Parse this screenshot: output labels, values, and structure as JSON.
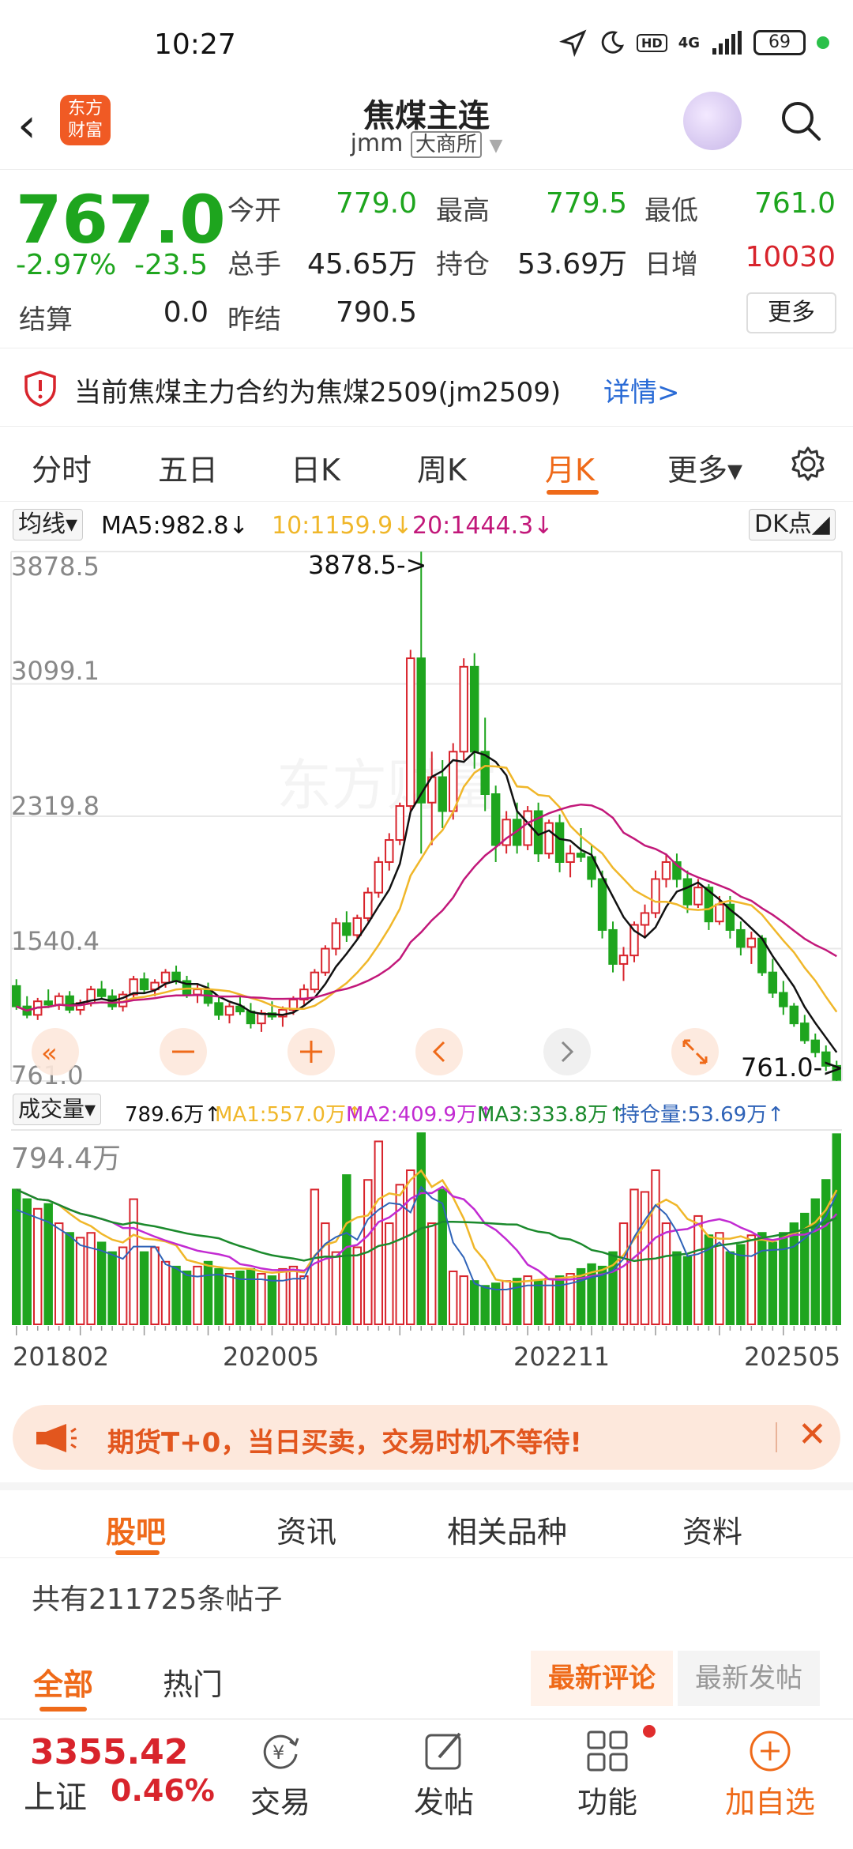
{
  "status": {
    "time": "10:27",
    "network": "4G",
    "hd": "HD",
    "battery": "69"
  },
  "header": {
    "title": "焦煤主连",
    "code": "jmm",
    "exchange": "大商所",
    "logo_line1": "东方",
    "logo_line2": "财富"
  },
  "quote": {
    "price": "767.0",
    "change_pct": "-2.97%",
    "change": "-23.5",
    "open_label": "今开",
    "open": "779.0",
    "high_label": "最高",
    "high": "779.5",
    "low_label": "最低",
    "low": "761.0",
    "volume_label": "总手",
    "volume": "45.65万",
    "oi_label": "持仓",
    "oi": "53.69万",
    "oi_inc_label": "日增",
    "oi_inc": "10030",
    "settle_label": "结算",
    "settle": "0.0",
    "prev_settle_label": "昨结",
    "prev_settle": "790.5",
    "more_label": "更多"
  },
  "notice": {
    "text": "当前焦煤主力合约为焦煤2509(jm2509)",
    "link": "详情>"
  },
  "tabs": [
    "分时",
    "五日",
    "日K",
    "周K",
    "月K",
    "更多▾"
  ],
  "ma_legend": {
    "select": "均线▾",
    "ma5": "MA5:982.8↓",
    "ma10": "10:1159.9↓",
    "ma20": "20:1444.3↓",
    "dk": "DK点◢"
  },
  "colors": {
    "accent": "#ef6a19",
    "up": "#d8242c",
    "down": "#1ea51e",
    "ma5": "#111111",
    "ma10": "#f0b72a",
    "ma20": "#c2187a",
    "ma3": "#1b8a2c",
    "oi_line": "#2f63b8"
  },
  "kchart": {
    "y_labels": [
      "3878.5",
      "3099.1",
      "2319.8",
      "1540.4",
      "761.0"
    ],
    "max_callout": "3878.5->",
    "min_callout": "761.0->",
    "watermark": "东方财富"
  },
  "vol_legend": {
    "select": "成交量▾",
    "vol": "789.6万↑",
    "ma1": "MA1:557.0万↑",
    "ma2": "MA2:409.9万↑",
    "ma3": "MA3:333.8万↑",
    "oi": "持仓量:53.69万↑"
  },
  "volchart": {
    "y_label": "794.4万"
  },
  "x_labels": [
    "201802",
    "202005",
    "202211",
    "202505"
  ],
  "promo": {
    "text": "期货T+0，当日买卖，交易时机不等待!"
  },
  "subtabs": [
    "股吧",
    "资讯",
    "相关品种",
    "资料"
  ],
  "post_count": "共有211725条帖子",
  "filter": {
    "all": "全部",
    "hot": "热门",
    "latest_comment": "最新评论",
    "latest_post": "最新发帖"
  },
  "bottom": {
    "index_value": "3355.42",
    "index_name": "上证",
    "index_pct": "0.46%",
    "nav": [
      "交易",
      "发帖",
      "功能",
      "加自选"
    ]
  },
  "chart_data": {
    "type": "candlestick",
    "title": "焦煤主连 月K",
    "ylim": [
      761.0,
      3878.5
    ],
    "y_ticks": [
      3878.5,
      3099.1,
      2319.8,
      1540.4,
      761.0
    ],
    "x_ticks": [
      "201802",
      "202005",
      "202211",
      "202505"
    ],
    "ohlc": [
      [
        1320,
        1360,
        1180,
        1200
      ],
      [
        1200,
        1260,
        1130,
        1150
      ],
      [
        1150,
        1250,
        1120,
        1230
      ],
      [
        1230,
        1300,
        1190,
        1210
      ],
      [
        1210,
        1280,
        1180,
        1260
      ],
      [
        1260,
        1290,
        1160,
        1180
      ],
      [
        1180,
        1240,
        1150,
        1220
      ],
      [
        1220,
        1320,
        1200,
        1300
      ],
      [
        1300,
        1350,
        1240,
        1260
      ],
      [
        1260,
        1300,
        1180,
        1200
      ],
      [
        1200,
        1290,
        1170,
        1270
      ],
      [
        1270,
        1380,
        1250,
        1360
      ],
      [
        1360,
        1400,
        1280,
        1300
      ],
      [
        1300,
        1360,
        1260,
        1340
      ],
      [
        1340,
        1420,
        1310,
        1400
      ],
      [
        1400,
        1440,
        1330,
        1350
      ],
      [
        1350,
        1380,
        1250,
        1270
      ],
      [
        1270,
        1330,
        1220,
        1300
      ],
      [
        1300,
        1340,
        1200,
        1220
      ],
      [
        1220,
        1260,
        1120,
        1150
      ],
      [
        1150,
        1220,
        1100,
        1200
      ],
      [
        1200,
        1260,
        1150,
        1170
      ],
      [
        1170,
        1220,
        1070,
        1100
      ],
      [
        1100,
        1180,
        1050,
        1160
      ],
      [
        1160,
        1230,
        1120,
        1140
      ],
      [
        1140,
        1200,
        1080,
        1180
      ],
      [
        1180,
        1260,
        1150,
        1240
      ],
      [
        1240,
        1330,
        1210,
        1300
      ],
      [
        1300,
        1420,
        1280,
        1400
      ],
      [
        1400,
        1560,
        1380,
        1540
      ],
      [
        1540,
        1720,
        1500,
        1690
      ],
      [
        1690,
        1760,
        1580,
        1620
      ],
      [
        1620,
        1740,
        1600,
        1720
      ],
      [
        1720,
        1900,
        1700,
        1870
      ],
      [
        1870,
        2080,
        1840,
        2050
      ],
      [
        2050,
        2220,
        2000,
        2180
      ],
      [
        2180,
        2400,
        2150,
        2380
      ],
      [
        2380,
        3300,
        2350,
        3250
      ],
      [
        3250,
        3878,
        2100,
        2400
      ],
      [
        2400,
        2700,
        2150,
        2550
      ],
      [
        2550,
        2650,
        2250,
        2350
      ],
      [
        2350,
        2750,
        2300,
        2700
      ],
      [
        2700,
        3250,
        2650,
        3200
      ],
      [
        3200,
        3280,
        2600,
        2700
      ],
      [
        2700,
        2900,
        2350,
        2450
      ],
      [
        2450,
        2500,
        2050,
        2150
      ],
      [
        2150,
        2350,
        2100,
        2300
      ],
      [
        2300,
        2400,
        2100,
        2150
      ],
      [
        2150,
        2380,
        2120,
        2350
      ],
      [
        2350,
        2400,
        2050,
        2100
      ],
      [
        2100,
        2300,
        2070,
        2280
      ],
      [
        2280,
        2330,
        1990,
        2050
      ],
      [
        2050,
        2150,
        1960,
        2100
      ],
      [
        2100,
        2250,
        2050,
        2080
      ],
      [
        2080,
        2150,
        1900,
        1950
      ],
      [
        1950,
        2000,
        1600,
        1650
      ],
      [
        1650,
        1700,
        1400,
        1450
      ],
      [
        1450,
        1550,
        1350,
        1500
      ],
      [
        1500,
        1700,
        1460,
        1680
      ],
      [
        1680,
        1800,
        1600,
        1750
      ],
      [
        1750,
        2000,
        1720,
        1950
      ],
      [
        1950,
        2100,
        1900,
        2050
      ],
      [
        2050,
        2100,
        1900,
        1950
      ],
      [
        1950,
        2000,
        1750,
        1800
      ],
      [
        1800,
        1950,
        1780,
        1900
      ],
      [
        1900,
        1920,
        1650,
        1700
      ],
      [
        1700,
        1850,
        1680,
        1800
      ],
      [
        1800,
        1850,
        1600,
        1650
      ],
      [
        1650,
        1700,
        1500,
        1550
      ],
      [
        1550,
        1640,
        1450,
        1600
      ],
      [
        1600,
        1620,
        1380,
        1400
      ],
      [
        1400,
        1480,
        1250,
        1280
      ],
      [
        1280,
        1350,
        1150,
        1200
      ],
      [
        1200,
        1220,
        1080,
        1100
      ],
      [
        1100,
        1150,
        980,
        1000
      ],
      [
        1000,
        1040,
        900,
        930
      ],
      [
        930,
        970,
        820,
        850
      ],
      [
        850,
        880,
        761,
        767
      ]
    ],
    "volume_series": [
      {
        "name": "成交量",
        "values": [
          560,
          520,
          480,
          500,
          420,
          380,
          360,
          380,
          340,
          300,
          320,
          520,
          300,
          320,
          260,
          240,
          220,
          240,
          260,
          230,
          210,
          220,
          230,
          210,
          200,
          230,
          240,
          200,
          560,
          420,
          300,
          620,
          320,
          600,
          760,
          420,
          580,
          640,
          794,
          420,
          560,
          220,
          200,
          180,
          160,
          170,
          180,
          190,
          200,
          180,
          190,
          200,
          210,
          230,
          250,
          240,
          300,
          420,
          560,
          550,
          640,
          420,
          300,
          280,
          450,
          370,
          380,
          300,
          330,
          370,
          380,
          340,
          380,
          420,
          460,
          520,
          600,
          790
        ]
      }
    ],
    "volume_max": 794.4
  }
}
